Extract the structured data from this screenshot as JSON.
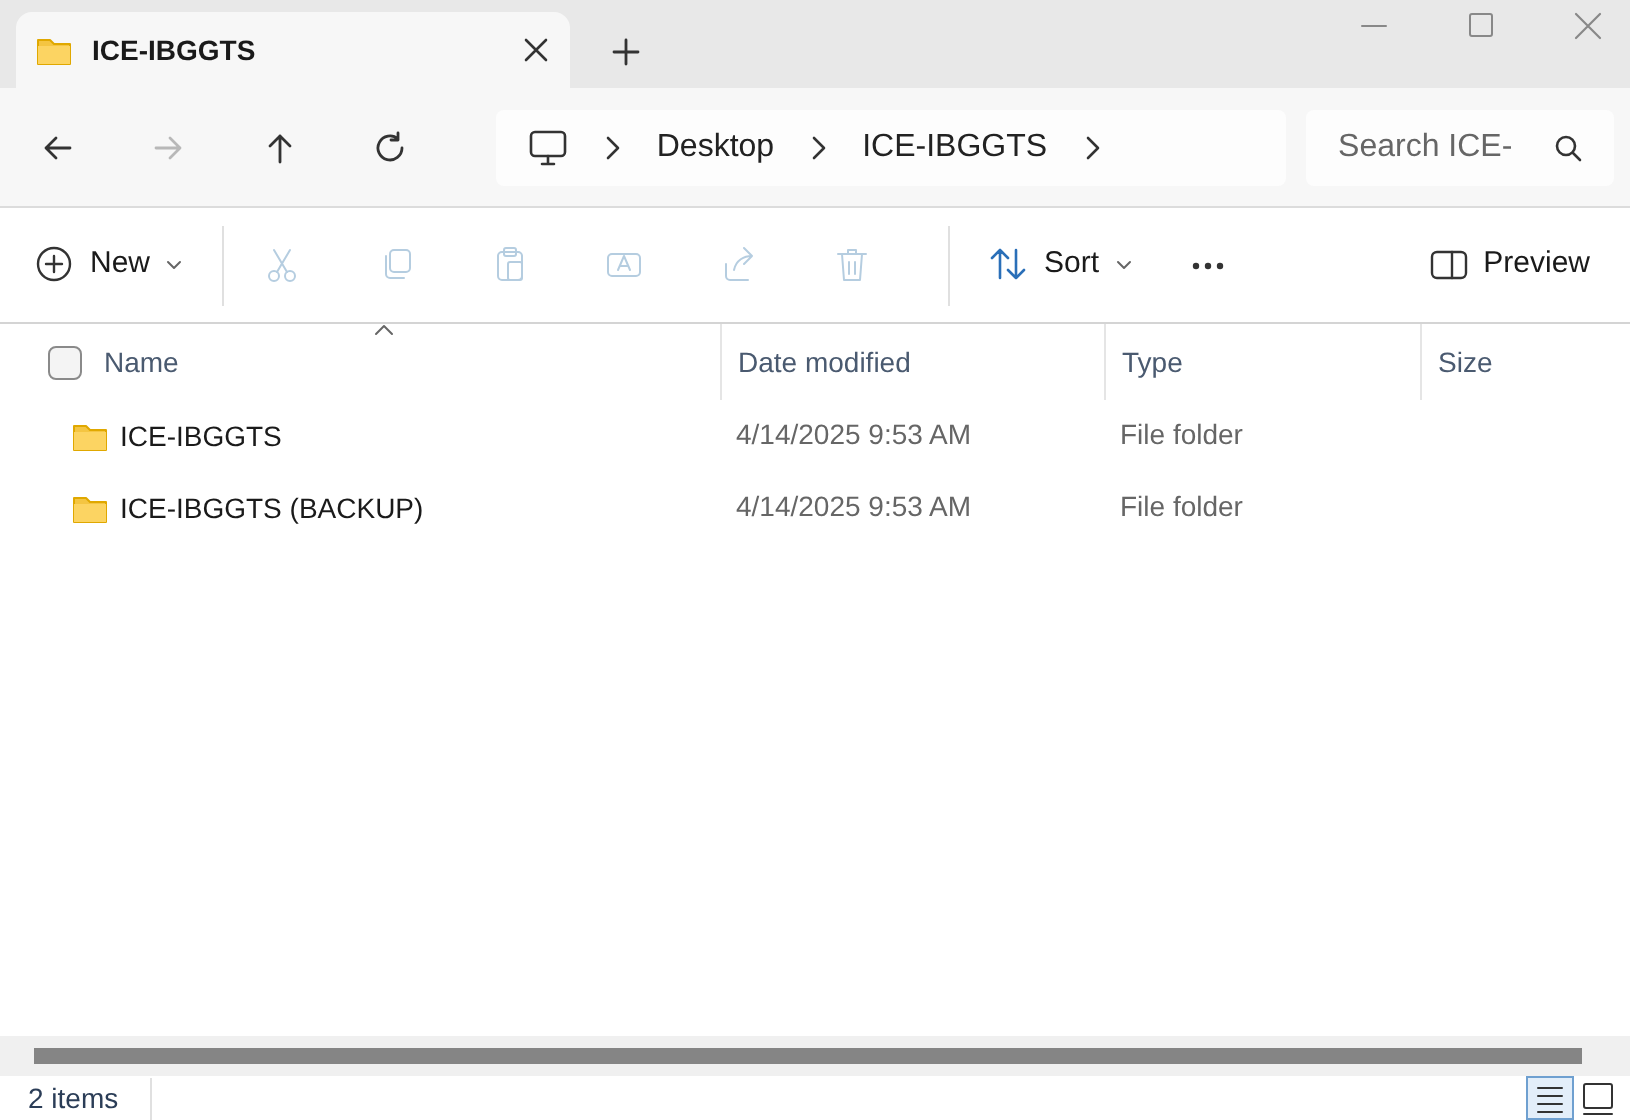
{
  "tabs": [
    {
      "label": "ICE-IBGGTS",
      "selected": true
    }
  ],
  "breadcrumb": [
    "Desktop",
    "ICE-IBGGTS"
  ],
  "nav_buttons": [
    {
      "kind": "back",
      "disabled": false
    },
    {
      "kind": "forward",
      "disabled": true
    },
    {
      "kind": "up",
      "disabled": false
    },
    {
      "kind": "refresh",
      "disabled": false
    }
  ],
  "search": {
    "placeholder": "Search ICE-"
  },
  "toolbar": [
    {
      "kind": "new",
      "label": "New",
      "disabled": false
    },
    {
      "kind": "cut",
      "disabled": true
    },
    {
      "kind": "copy",
      "disabled": true
    },
    {
      "kind": "paste",
      "disabled": true
    },
    {
      "kind": "rename",
      "disabled": true
    },
    {
      "kind": "share",
      "disabled": true
    },
    {
      "kind": "delete",
      "disabled": true
    },
    {
      "kind": "sort",
      "label": "Sort",
      "disabled": false
    },
    {
      "kind": "more",
      "disabled": false
    },
    {
      "kind": "preview",
      "label": "Preview",
      "disabled": false
    }
  ],
  "table": {
    "select_all": {
      "checked": false
    },
    "columns": [
      "Name",
      "Date modified",
      "Type",
      "Size"
    ],
    "rows": [
      {
        "name": "ICE-IBGGTS",
        "date": "4/14/2025 9:53 AM",
        "type": "File folder"
      },
      {
        "name": "ICE-IBGGTS (BACKUP)",
        "date": "4/14/2025 9:53 AM",
        "type": "File folder"
      }
    ]
  },
  "status_bar": {
    "count": "2 items",
    "views": [
      {
        "kind": "details",
        "selected": true
      },
      {
        "kind": "tiles",
        "selected": false
      }
    ]
  }
}
